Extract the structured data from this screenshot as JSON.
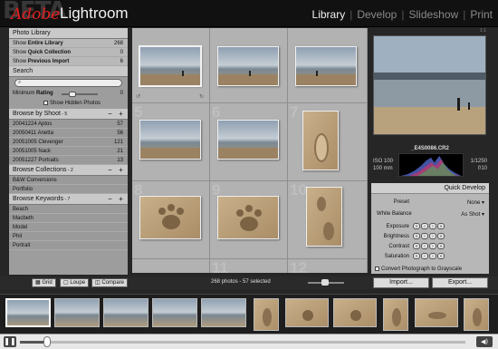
{
  "header": {
    "watermark": "BETA",
    "brand_adobe": "Adobe",
    "brand_product": "Lightroom",
    "modules": [
      "Library",
      "Develop",
      "Slideshow",
      "Print"
    ],
    "active_module": "Library"
  },
  "left_panel": {
    "photo_library": {
      "title": "Photo Library",
      "rows": [
        {
          "prefix": "Show ",
          "bold": "Entire Library",
          "count": "268"
        },
        {
          "prefix": "Show ",
          "bold": "Quick Collection",
          "count": "0"
        },
        {
          "prefix": "Show ",
          "bold": "Previous Import",
          "count": "6"
        }
      ]
    },
    "search": {
      "title": "Search",
      "placeholder": "",
      "min_rating_label": "Minimum ",
      "min_rating_bold": "Rating",
      "min_rating_value": "0",
      "show_hidden": "Show Hidden Photos"
    },
    "shoots": {
      "title": "Browse by Shoot",
      "count_suffix": " - 5",
      "minus": "−",
      "plus": "+",
      "items": [
        {
          "label": "20041224 Aptos",
          "count": "57"
        },
        {
          "label": "20050411 Anetta",
          "count": "56"
        },
        {
          "label": "20051005 Clevenger",
          "count": "121"
        },
        {
          "label": "20051005 Nack",
          "count": "21"
        },
        {
          "label": "20051227 Portraits",
          "count": "13"
        }
      ]
    },
    "collections": {
      "title": "Browse Collections",
      "count_suffix": " - 2",
      "items": [
        "B&W Conversions",
        "Portfolio"
      ]
    },
    "keywords": {
      "title": "Browse Keywords",
      "count_suffix": " - 7",
      "items": [
        "Beach",
        "Macbeth",
        "Model",
        "Phil",
        "Portrait"
      ]
    }
  },
  "grid": {
    "cell_numbers": [
      "5",
      "6",
      "7",
      "8",
      "9",
      "10",
      "11",
      "12"
    ]
  },
  "right_panel": {
    "navigator_label": "1:1",
    "filename": "_E4S0086.CR2",
    "iso": "ISO 100",
    "focal": "100 mm",
    "shutter": "1/1250",
    "aperture": "f/10",
    "quick_develop": {
      "title": "Quick Develop",
      "preset_label": "Preset",
      "preset_value": "None ▾",
      "wb_label": "White Balance",
      "wb_value": "As Shot ▾",
      "adjustments": [
        "Exposure",
        "Brightness",
        "Contrast",
        "Saturation"
      ],
      "button_glyphs": [
        "«",
        "‹",
        "›",
        "»"
      ],
      "grayscale": "Convert Photograph to Grayscale"
    },
    "import_label": "Import...",
    "export_label": "Export..."
  },
  "toolbar": {
    "grid_label": "Grid",
    "loupe_label": "Loupe",
    "compare_label": "Compare",
    "status": "268 photos - 57 selected"
  },
  "player": {
    "play_glyph": "❚❚",
    "progress_fraction": 0.06,
    "volume_glyph": "◀)"
  },
  "colors": {
    "accent_red": "#e02020",
    "panel_gray": "#9d9d9d",
    "grid_gray": "#a9a9a9"
  }
}
